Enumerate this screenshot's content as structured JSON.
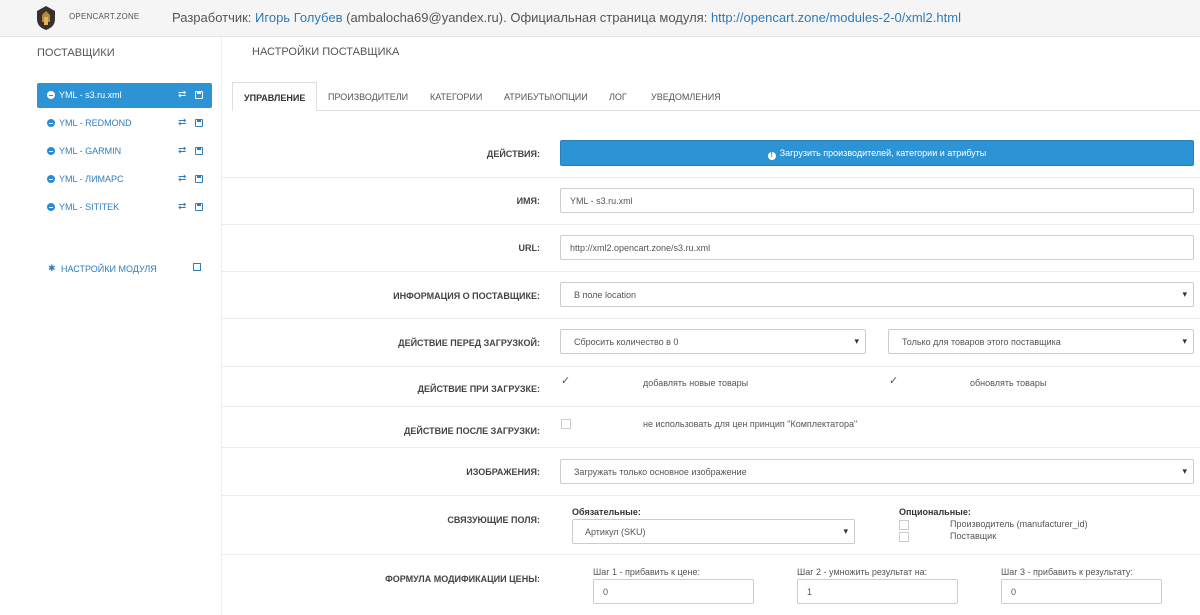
{
  "header": {
    "logo_text": "OPENCART.ZONE",
    "developer_label": "Разработчик:",
    "developer_name": "Игорь Голубев",
    "developer_email": "(ambalocha69@yandex.ru). Официальная страница модуля:",
    "module_url": "http://opencart.zone/modules-2-0/xml2.html"
  },
  "sidebar": {
    "title": "ПОСТАВЩИКИ",
    "items": [
      {
        "label": "YML - s3.ru.xml",
        "active": true
      },
      {
        "label": "YML - REDMOND"
      },
      {
        "label": "YML - GARMIN"
      },
      {
        "label": "YML - ЛИМАРС"
      },
      {
        "label": "YML - SITITEK"
      }
    ],
    "module_settings": "НАСТРОЙКИ МОДУЛЯ"
  },
  "main": {
    "title": "НАСТРОЙКИ ПОСТАВЩИКА",
    "tabs": [
      "УПРАВЛЕНИЕ",
      "ПРОИЗВОДИТЕЛИ",
      "КАТЕГОРИИ",
      "АТРИБУТЫ\\ОПЦИИ",
      "ЛОГ",
      "УВЕДОМЛЕНИЯ"
    ],
    "actions_label": "ДЕЙСТВИЯ:",
    "load_button": "Загрузить производителей, категории и атрибуты",
    "name_label": "ИМЯ:",
    "name_value": "YML - s3.ru.xml",
    "url_label": "URL:",
    "url_value": "http://xml2.opencart.zone/s3.ru.xml",
    "supplier_info_label": "ИНФОРМАЦИЯ О ПОСТАВЩИКЕ:",
    "supplier_info_value": "В поле location",
    "before_load_label": "ДЕЙСТВИЕ ПЕРЕД ЗАГРУЗКОЙ:",
    "before_load_value": "Сбросить количество в 0",
    "before_load_scope": "Только для товаров этого поставщика",
    "during_load_label": "ДЕЙСТВИЕ ПРИ ЗАГРУЗКЕ:",
    "add_new": "добавлять новые товары",
    "update": "обновлять товары",
    "after_load_label": "ДЕЙСТВИЕ ПОСЛЕ ЗАГРУЗКИ:",
    "no_bundler": "не использовать для цен принцип \"Комплектатора\"",
    "images_label": "ИЗОБРАЖЕНИЯ:",
    "images_value": "Загружать только основное изображение",
    "link_fields_label": "СВЯЗУЮЩИЕ ПОЛЯ:",
    "required_title": "Обязательные:",
    "required_value": "Артикул (SKU)",
    "optional_title": "Опциональные:",
    "optional_manufacturer": "Производитель (manufacturer_id)",
    "optional_supplier": "Поставщик",
    "price_formula_label": "ФОРМУЛА МОДИФИКАЦИИ ЦЕНЫ:",
    "step1_label": "Шаг 1 - прибавить к цене:",
    "step1_value": "0",
    "step2_label": "Шаг 2 - умножить результат на:",
    "step2_value": "1",
    "step3_label": "Шаг 3 - прибавить к результату:",
    "step3_value": "0"
  },
  "colors": {
    "accent": "#2c93d5",
    "link": "#2e7dbd"
  }
}
